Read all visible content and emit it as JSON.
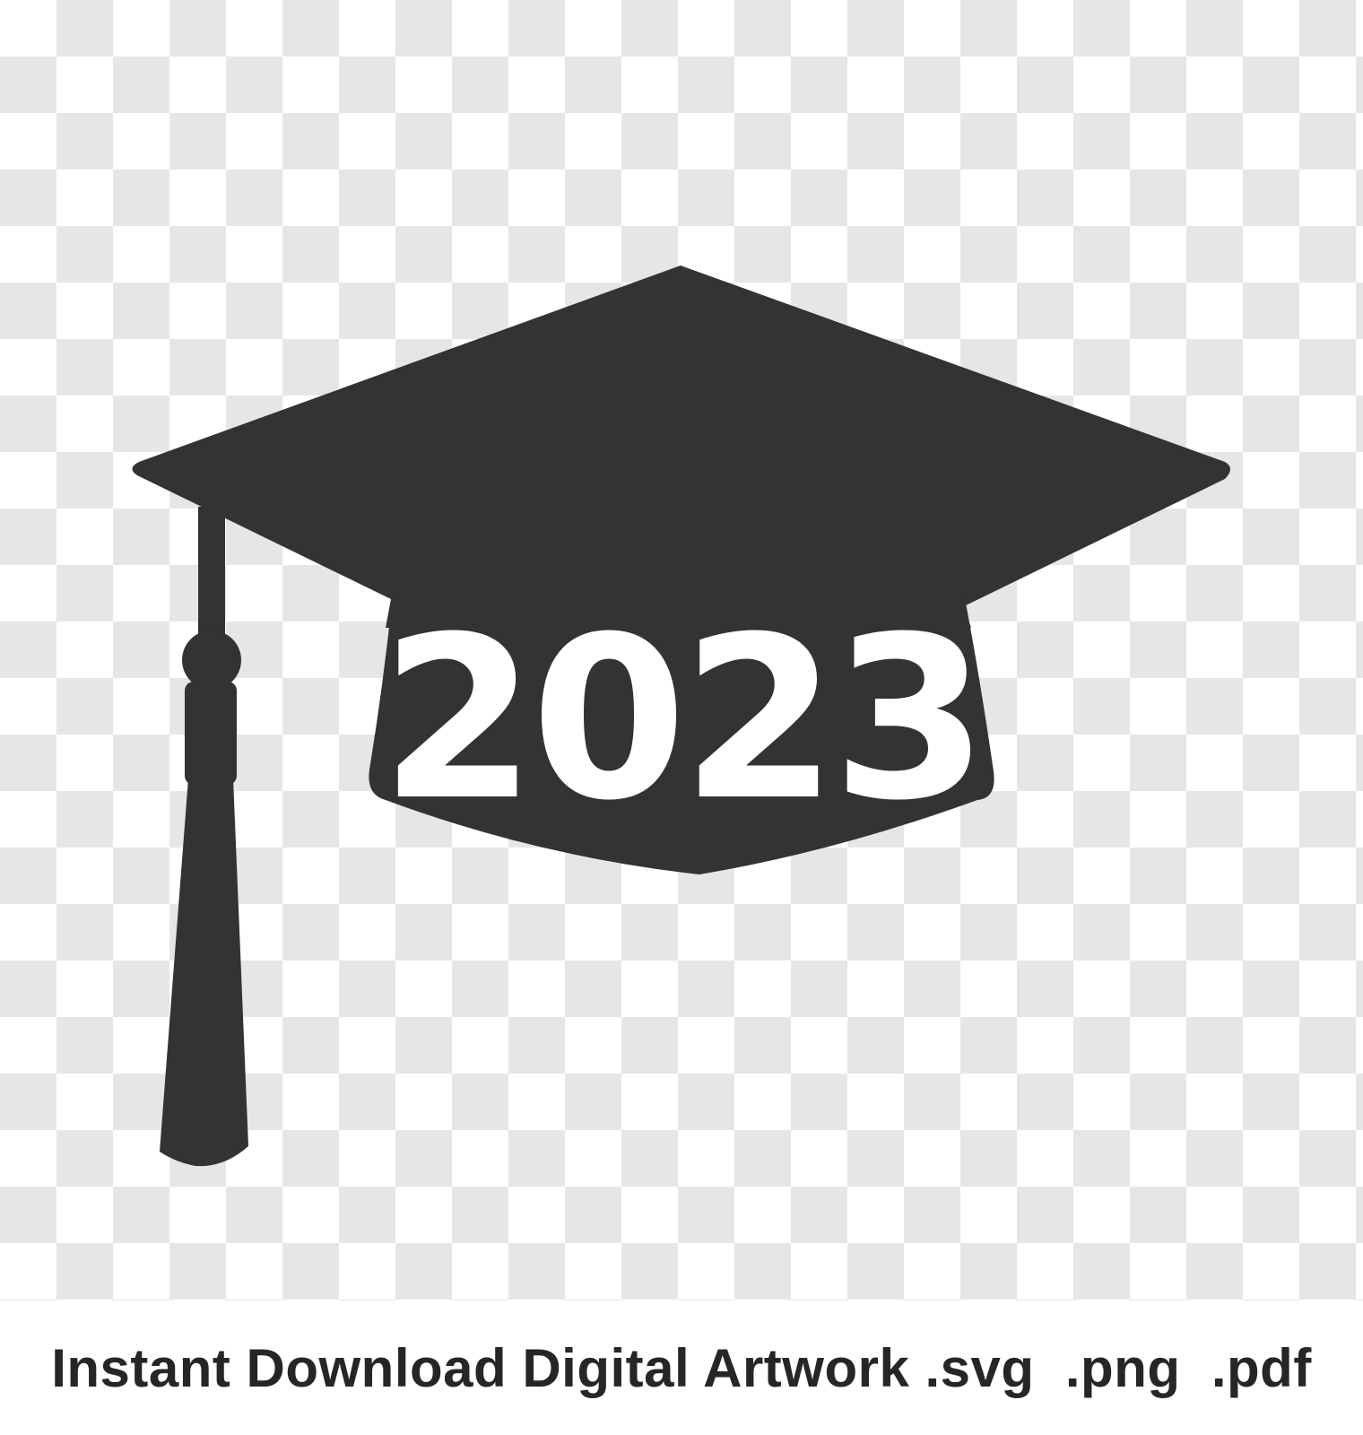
{
  "artwork": {
    "year_text": "2023",
    "icon_color": "#333333",
    "text_color": "#ffffff",
    "background": "transparency-checkerboard",
    "checker_colors": [
      "#ffffff",
      "#e6e6e6"
    ]
  },
  "caption": {
    "text": "Instant Download Digital Artwork .svg  .png  .pdf"
  }
}
